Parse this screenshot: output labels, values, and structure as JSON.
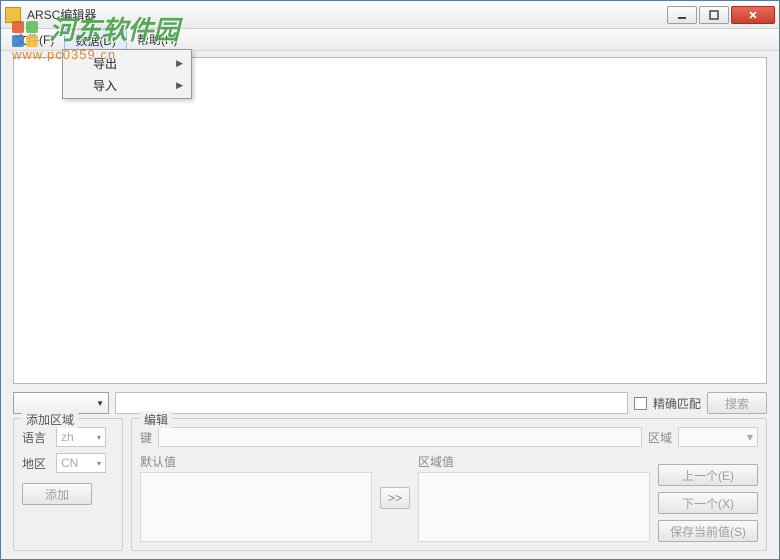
{
  "window": {
    "title": "ARSC编辑器"
  },
  "menubar": {
    "file": "文件(F)",
    "data": "数据(D)",
    "help": "帮助(H)"
  },
  "dropdown": {
    "export": "导出",
    "import": "导入"
  },
  "search": {
    "exact_match_label": "精确匹配",
    "search_btn": "搜索"
  },
  "add_region": {
    "group_title": "添加区域",
    "language_label": "语言",
    "language_value": "zh",
    "region_label": "地区",
    "region_value": "CN",
    "add_btn": "添加"
  },
  "edit": {
    "group_title": "编辑",
    "key_label": "键",
    "region_label": "区域",
    "default_label": "默认值",
    "region_value_label": "区域值",
    "copy_btn": ">>",
    "prev_btn": "上一个(E)",
    "next_btn": "下一个(X)",
    "save_btn": "保存当前值(S)"
  },
  "watermark": {
    "line1": "河东软件园",
    "line2": "www.pc0359.cn"
  }
}
